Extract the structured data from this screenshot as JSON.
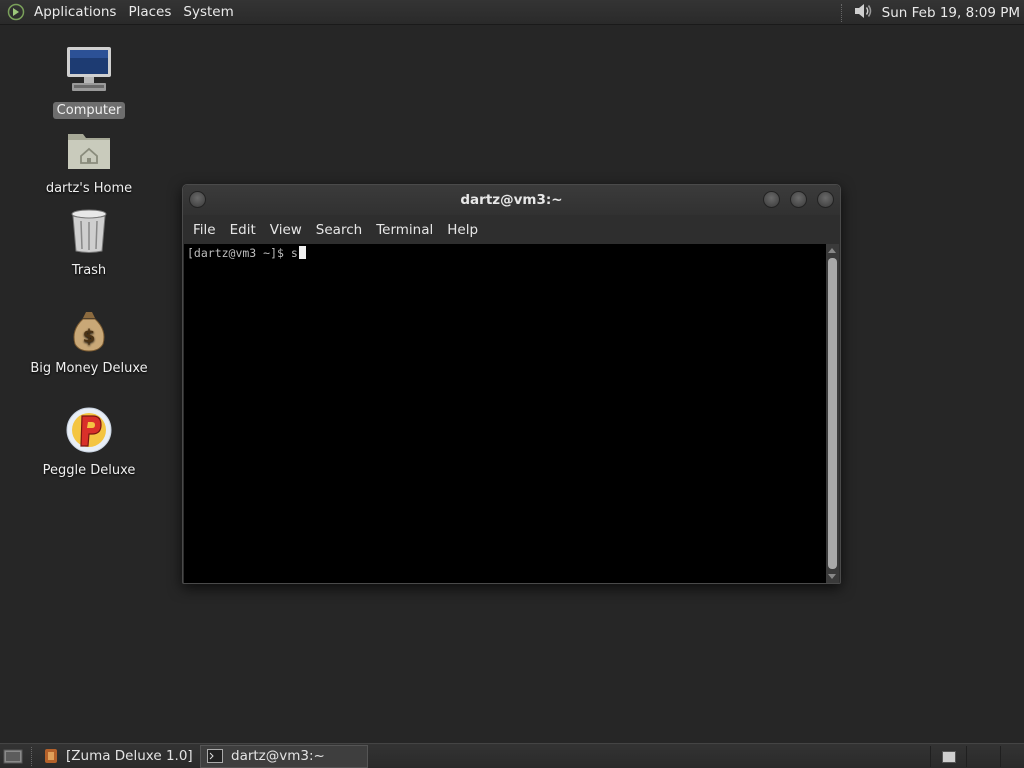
{
  "top_panel": {
    "menus": [
      "Applications",
      "Places",
      "System"
    ],
    "clock": "Sun Feb 19,  8:09 PM"
  },
  "desktop_icons": [
    {
      "label": "Computer",
      "icon": "computer-icon"
    },
    {
      "label": "dartz's Home",
      "icon": "home-folder-icon"
    },
    {
      "label": "Trash",
      "icon": "trash-icon"
    },
    {
      "label": "Big Money Deluxe",
      "icon": "money-bag-icon"
    },
    {
      "label": "Peggle Deluxe",
      "icon": "peggle-icon"
    }
  ],
  "terminal": {
    "title": "dartz@vm3:~",
    "menus": [
      "File",
      "Edit",
      "View",
      "Search",
      "Terminal",
      "Help"
    ],
    "prompt": "[dartz@vm3 ~]$ s"
  },
  "taskbar": {
    "tasks": [
      "[Zuma Deluxe 1.0]",
      "dartz@vm3:~"
    ]
  },
  "colors": {
    "desktop": "#262626",
    "panel": "#2e2e2e",
    "terminal_bg": "#000000",
    "selection": "#6e6e6e"
  }
}
